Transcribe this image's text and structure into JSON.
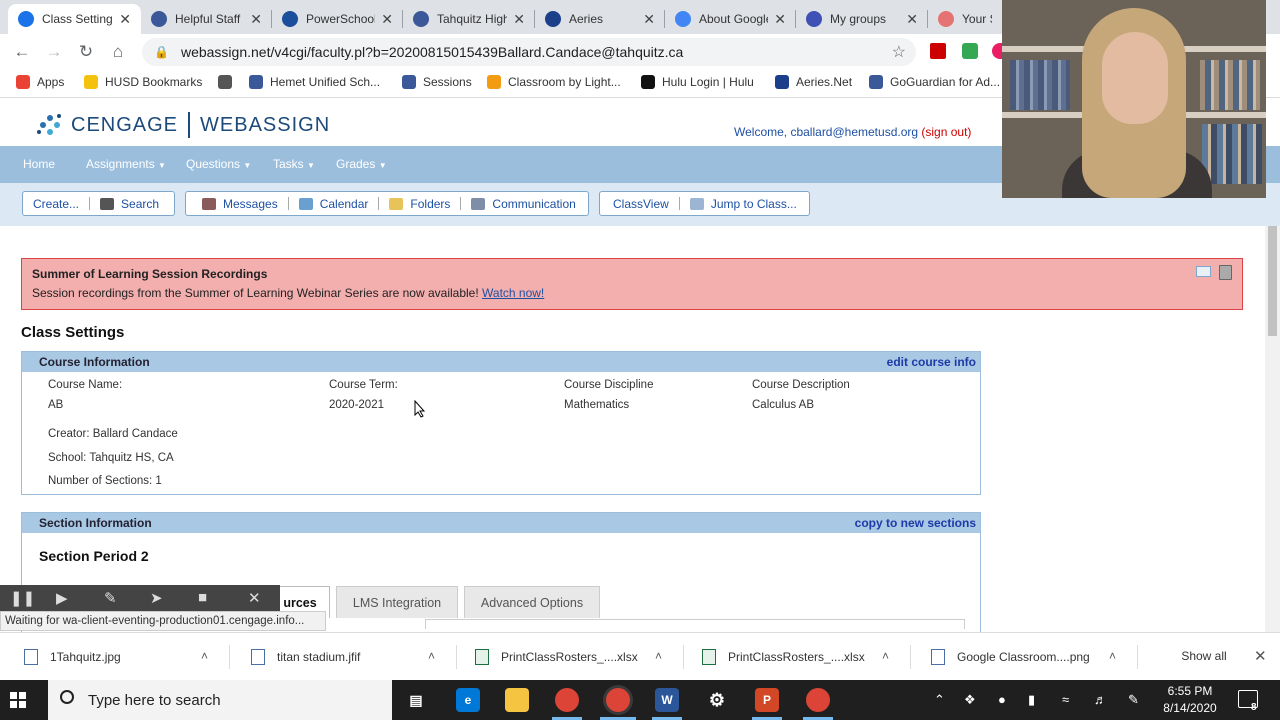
{
  "browser": {
    "tabs": [
      {
        "label": "Class Settings",
        "icon": "cengage-icon",
        "color": "#1a73e8"
      },
      {
        "label": "Helpful Staff",
        "icon": "hemet-icon",
        "color": "#3b5998"
      },
      {
        "label": "PowerSchool",
        "icon": "powerschool-icon",
        "color": "#1b4f9c"
      },
      {
        "label": "Tahquitz High",
        "icon": "hemet-icon",
        "color": "#3b5998"
      },
      {
        "label": "Aeries",
        "icon": "aeries-icon",
        "color": "#1b3f8b"
      },
      {
        "label": "About Google",
        "icon": "google-icon",
        "color": "#4285f4"
      },
      {
        "label": "My groups",
        "icon": "groups-icon",
        "color": "#3f51b5"
      },
      {
        "label": "Your Scr",
        "icon": "screencastify-icon",
        "color": "#e57373"
      }
    ],
    "url": "webassign.net/v4cgi/faculty.pl?b=20200815015439Ballard.Candace@tahquitz.ca",
    "bookmarks": [
      {
        "label": "Apps",
        "color": "#ea4335"
      },
      {
        "label": "HUSD Bookmarks",
        "color": "#f4c20d"
      },
      {
        "label": "",
        "color": "#555555"
      },
      {
        "label": "Hemet Unified Sch...",
        "color": "#3b5998"
      },
      {
        "label": "Sessions",
        "color": "#3b5998"
      },
      {
        "label": "Classroom by Light...",
        "color": "#f39c12"
      },
      {
        "label": "Hulu Login | Hulu",
        "color": "#111111"
      },
      {
        "label": "Aeries.Net",
        "color": "#1b3f8b"
      },
      {
        "label": "GoGuardian for Ad...",
        "color": "#3b5998"
      }
    ]
  },
  "site": {
    "logo_left": "CENGAGE",
    "logo_right": "WEBASSIGN",
    "welcome": "Welcome, cballard@hemetusd.org",
    "sign_out": "(sign out)",
    "nav": [
      "Home",
      "Assignments",
      "Questions",
      "Tasks",
      "Grades"
    ],
    "toolbar": {
      "create": "Create...",
      "search": "Search",
      "messages": "Messages",
      "calendar": "Calendar",
      "folders": "Folders",
      "communication": "Communication",
      "classview": "ClassView",
      "jump": "Jump to Class..."
    }
  },
  "alert": {
    "title": "Summer of Learning Session Recordings",
    "body": "Session recordings from the Summer of Learning Webinar Series are now available!",
    "link": "Watch now!"
  },
  "page_title": "Class Settings",
  "course_info": {
    "header": "Course Information",
    "edit_link": "edit course info",
    "name_label": "Course Name:",
    "name_value": "AB",
    "term_label": "Course Term:",
    "term_value": "2020-2021",
    "discipline_label": "Course Discipline",
    "discipline_value": "Mathematics",
    "description_label": "Course Description",
    "description_value": "Calculus AB",
    "creator": "Creator: Ballard Candace",
    "school": "School: Tahquitz HS, CA",
    "sections": "Number of Sections: 1"
  },
  "section_info": {
    "header": "Section Information",
    "copy_link": "copy to new sections",
    "section_title": "Section Period 2",
    "tabs": [
      "urces",
      "LMS Integration",
      "Advanced Options"
    ]
  },
  "status_text": "Waiting for wa-client-eventing-production01.cengage.info...",
  "downloads": {
    "items": [
      "1Tahquitz.jpg",
      "titan stadium.jfif",
      "PrintClassRosters_....xlsx",
      "PrintClassRosters_....xlsx",
      "Google Classroom....png"
    ],
    "show_all": "Show all"
  },
  "taskbar": {
    "search_placeholder": "Type here to search",
    "time": "6:55 PM",
    "date": "8/14/2020",
    "notification_count": "8"
  }
}
